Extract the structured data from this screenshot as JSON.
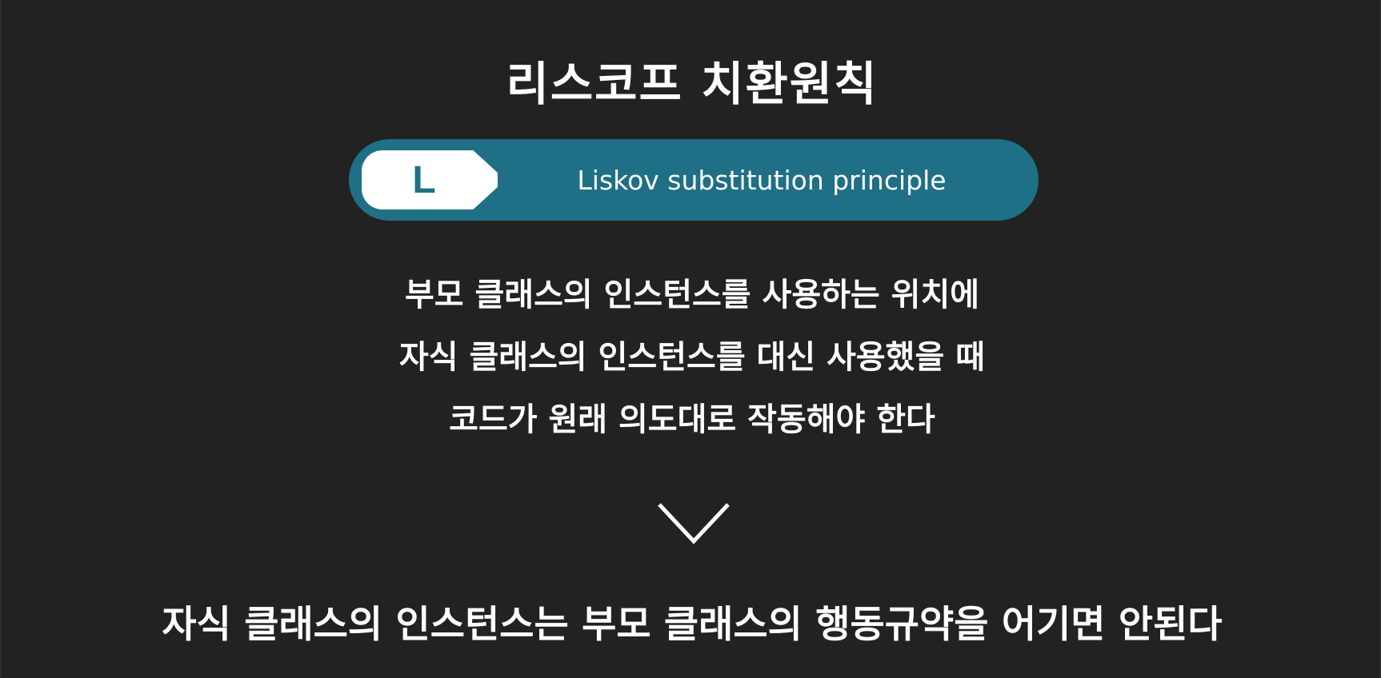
{
  "slide": {
    "title": "리스코프 치환원칙",
    "badge_letter": "L",
    "principle_name": "Liskov substitution principle",
    "description_lines": [
      "부모 클래스의 인스턴스를 사용하는 위치에",
      "자식 클래스의 인스턴스를 대신 사용했을 때",
      "코드가 원래 의도대로 작동해야 한다"
    ],
    "arrow_icon": "down-arrow-icon",
    "conclusion": "자식 클래스의 인스턴스는 부모 클래스의 행동규약을 어기면 안된다"
  },
  "colors": {
    "background": "#222222",
    "pill": "#1f6f86",
    "text": "#ffffff"
  }
}
